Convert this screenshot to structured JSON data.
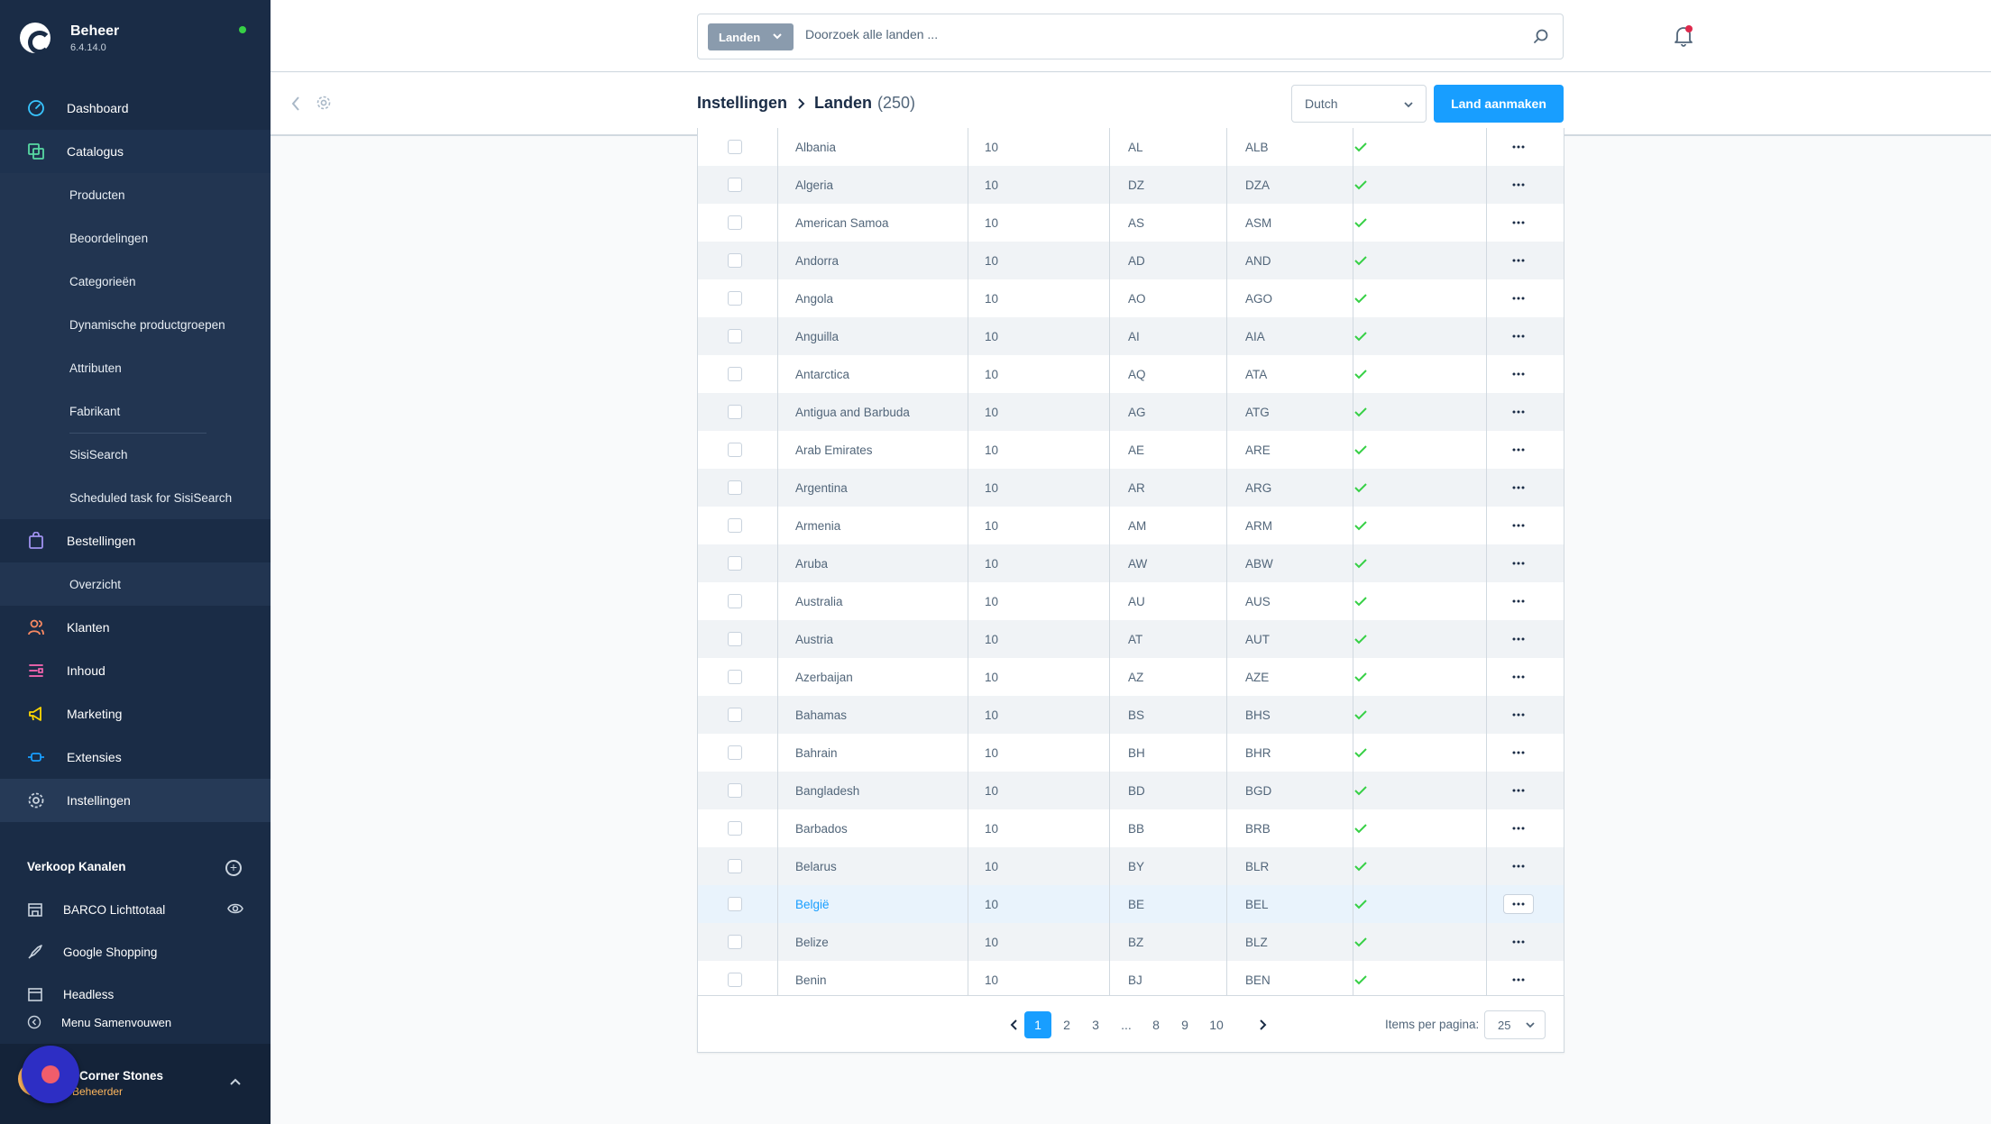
{
  "app": {
    "title": "Beheer",
    "version": "6.4.14.0"
  },
  "colors": {
    "sidebar": "#1a2c46",
    "accent": "#189eff",
    "check": "#37d046",
    "notification": "#de294c"
  },
  "nav": {
    "dashboard": "Dashboard",
    "catalog": "Catalogus",
    "catalog_items": [
      "Producten",
      "Beoordelingen",
      "Categorieën",
      "Dynamische productgroepen",
      "Attributen",
      "Fabrikant",
      "SisiSearch",
      "Scheduled task for SisiSearch"
    ],
    "orders": "Bestellingen",
    "orders_items": [
      "Overzicht"
    ],
    "customers": "Klanten",
    "content": "Inhoud",
    "marketing": "Marketing",
    "extensions": "Extensies",
    "settings": "Instellingen"
  },
  "sales_channels": {
    "title": "Verkoop Kanalen",
    "items": [
      "BARCO Lichttotaal",
      "Google Shopping",
      "Headless"
    ]
  },
  "collapse_label": "Menu Samenvouwen",
  "user": {
    "name": "Corner Stones",
    "role": "Beheerder"
  },
  "search": {
    "type": "Landen",
    "placeholder": "Doorzoek alle landen ..."
  },
  "breadcrumb": {
    "parent": "Instellingen",
    "current": "Landen",
    "count": "(250)"
  },
  "language_select": "Dutch",
  "create_button": "Land aanmaken",
  "table": {
    "rows": [
      [
        "Albania",
        "10",
        "AL",
        "ALB"
      ],
      [
        "Algeria",
        "10",
        "DZ",
        "DZA"
      ],
      [
        "American Samoa",
        "10",
        "AS",
        "ASM"
      ],
      [
        "Andorra",
        "10",
        "AD",
        "AND"
      ],
      [
        "Angola",
        "10",
        "AO",
        "AGO"
      ],
      [
        "Anguilla",
        "10",
        "AI",
        "AIA"
      ],
      [
        "Antarctica",
        "10",
        "AQ",
        "ATA"
      ],
      [
        "Antigua and Barbuda",
        "10",
        "AG",
        "ATG"
      ],
      [
        "Arab Emirates",
        "10",
        "AE",
        "ARE"
      ],
      [
        "Argentina",
        "10",
        "AR",
        "ARG"
      ],
      [
        "Armenia",
        "10",
        "AM",
        "ARM"
      ],
      [
        "Aruba",
        "10",
        "AW",
        "ABW"
      ],
      [
        "Australia",
        "10",
        "AU",
        "AUS"
      ],
      [
        "Austria",
        "10",
        "AT",
        "AUT"
      ],
      [
        "Azerbaijan",
        "10",
        "AZ",
        "AZE"
      ],
      [
        "Bahamas",
        "10",
        "BS",
        "BHS"
      ],
      [
        "Bahrain",
        "10",
        "BH",
        "BHR"
      ],
      [
        "Bangladesh",
        "10",
        "BD",
        "BGD"
      ],
      [
        "Barbados",
        "10",
        "BB",
        "BRB"
      ],
      [
        "Belarus",
        "10",
        "BY",
        "BLR"
      ],
      [
        "België",
        "10",
        "BE",
        "BEL"
      ],
      [
        "Belize",
        "10",
        "BZ",
        "BLZ"
      ],
      [
        "Benin",
        "10",
        "BJ",
        "BEN"
      ]
    ],
    "highlighted_row": 20
  },
  "pagination": {
    "pages": [
      "1",
      "2",
      "3",
      "...",
      "8",
      "9",
      "10"
    ],
    "current": "1",
    "items_per_page_label": "Items per pagina:",
    "items_per_page": "25"
  }
}
